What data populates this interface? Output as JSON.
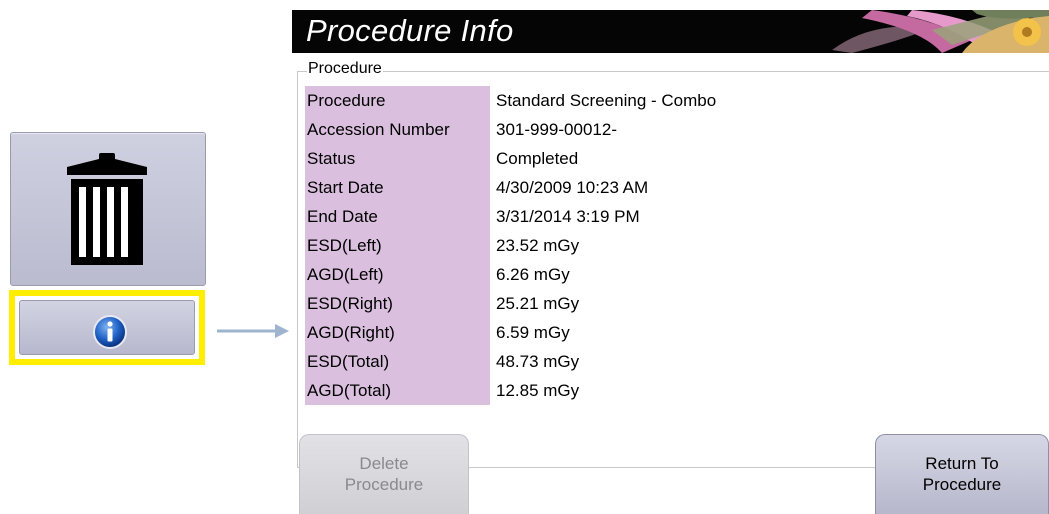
{
  "dialog": {
    "title": "Procedure Info",
    "group_label": "Procedure",
    "rows": [
      {
        "label": "Procedure",
        "value": "Standard Screening - Combo"
      },
      {
        "label": "Accession Number",
        "value": "301-999-00012-"
      },
      {
        "label": "Status",
        "value": "Completed"
      },
      {
        "label": "Start Date",
        "value": "4/30/2009 10:23 AM"
      },
      {
        "label": "End Date",
        "value": "3/31/2014 3:19 PM"
      },
      {
        "label": "ESD(Left)",
        "value": "23.52 mGy"
      },
      {
        "label": "AGD(Left)",
        "value": "6.26 mGy"
      },
      {
        "label": "ESD(Right)",
        "value": "25.21 mGy"
      },
      {
        "label": "AGD(Right)",
        "value": "6.59 mGy"
      },
      {
        "label": "ESD(Total)",
        "value": "48.73 mGy"
      },
      {
        "label": "AGD(Total)",
        "value": "12.85 mGy"
      }
    ],
    "buttons": {
      "delete_line1": "Delete",
      "delete_line2": "Procedure",
      "return_line1": "Return To",
      "return_line2": "Procedure"
    }
  },
  "toolbar": {
    "trash_icon": "trash-can-icon",
    "info_icon": "info-icon",
    "highlight_color": "#ffee00"
  },
  "colors": {
    "label_bg": "#dbbfdf",
    "title_bg": "#050505"
  }
}
